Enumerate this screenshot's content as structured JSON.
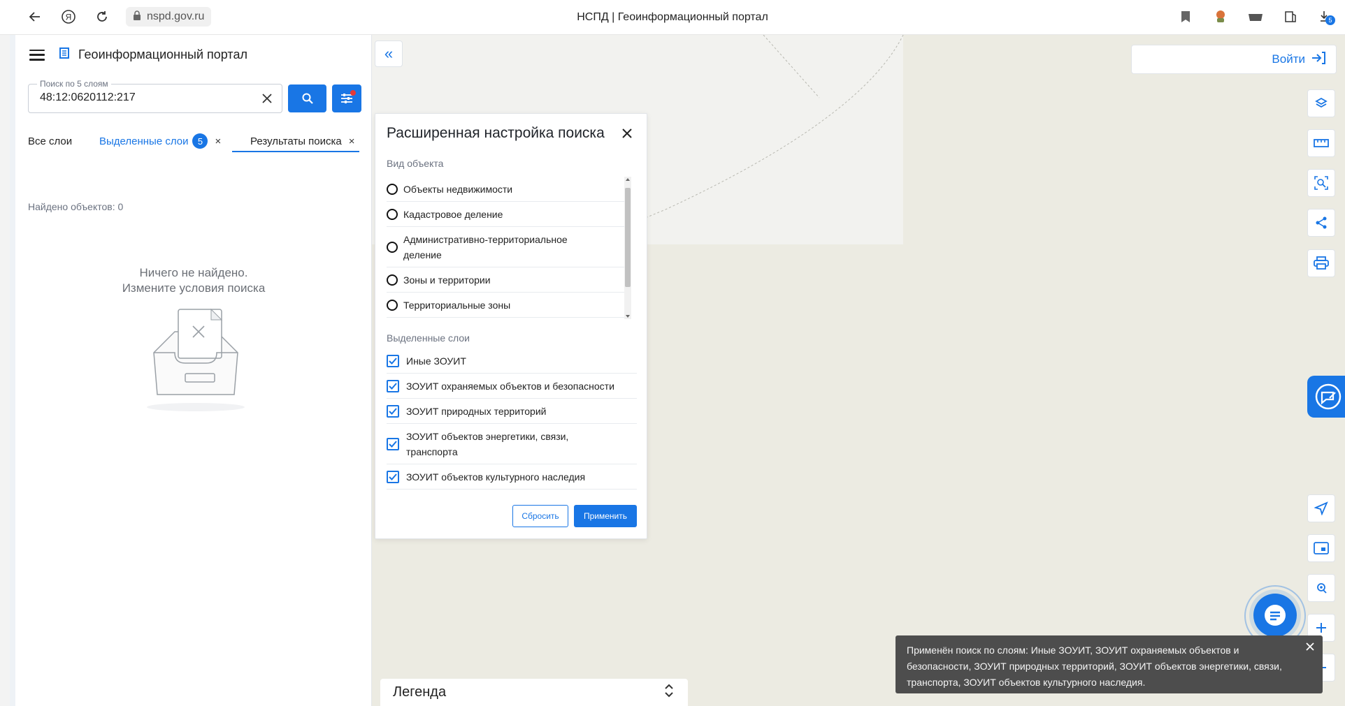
{
  "browser": {
    "url": "nspd.gov.ru",
    "tab_title": "НСПД | Геоинформационный портал",
    "download_badge": "5"
  },
  "panel": {
    "app_title": "Геоинформационный портал",
    "search": {
      "label": "Поиск по 5 слоям",
      "value": "48:12:0620112:217"
    },
    "tabs": [
      {
        "label": "Все слои"
      },
      {
        "label": "Выделенные слои",
        "badge": "5",
        "close": "×"
      },
      {
        "label": "Результаты поиска",
        "close": "×"
      }
    ],
    "found_text": "Найдено объектов: 0",
    "empty_line1": "Ничего не найдено.",
    "empty_line2": "Измените условия поиска"
  },
  "dialog": {
    "title": "Расширенная настройка поиска",
    "object_type_label": "Вид объекта",
    "object_types": [
      "Объекты недвижимости",
      "Кадастровое деление",
      "Административно-территориальное деление",
      "Зоны и территории",
      "Территориальные зоны"
    ],
    "selected_layers_label": "Выделенные слои",
    "layers": [
      "Иные ЗОУИТ",
      "ЗОУИТ охраняемых объектов и безопасности",
      "ЗОУИТ природных территорий",
      "ЗОУИТ объектов энергетики, связи, транспорта",
      "ЗОУИТ объектов культурного наследия"
    ],
    "reset_label": "Сбросить",
    "apply_label": "Применить"
  },
  "map": {
    "login_label": "Войти",
    "legend_label": "Легенда",
    "toast_text": "Применён поиск по слоям: Иные ЗОУИТ, ЗОУИТ охраняемых объектов и безопасности, ЗОУИТ природных территорий, ЗОУИТ объектов энергетики, связи, транспорта, ЗОУИТ объектов культурного наследия."
  },
  "colors": {
    "accent": "#1976e5",
    "map_bg": "#ecebe2",
    "toast_bg": "#4d4d4d"
  },
  "icons": [
    "back-icon",
    "yandex-icon",
    "reload-icon",
    "lock-icon",
    "bookmark-icon",
    "extension-icon",
    "download-icon",
    "layers-icon",
    "ruler-icon",
    "select-area-icon",
    "share-icon",
    "print-icon",
    "feedback-icon",
    "navigate-icon",
    "minimap-icon",
    "geolocation-icon",
    "zoom-in-icon",
    "zoom-out-icon",
    "chat-icon"
  ]
}
